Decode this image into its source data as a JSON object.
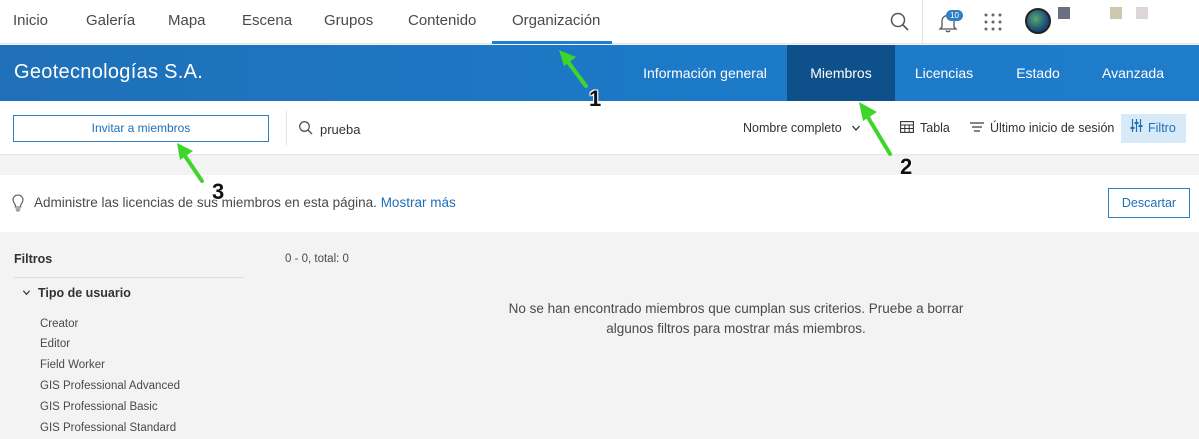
{
  "topnav": {
    "items": [
      "Inicio",
      "Galería",
      "Mapa",
      "Escena",
      "Grupos",
      "Contenido",
      "Organización"
    ],
    "active": "Organización",
    "notifications_count": "10"
  },
  "org": {
    "name": "Geotecnologías S.A.",
    "tabs": [
      "Información general",
      "Miembros",
      "Licencias",
      "Estado",
      "Avanzada"
    ],
    "selected_tab": "Miembros"
  },
  "toolbar": {
    "invite_label": "Invitar a miembros",
    "search_value": "prueba",
    "sort_label": "Nombre completo",
    "view_label": "Tabla",
    "last_login_label": "Último inicio de sesión",
    "filter_label": "Filtro"
  },
  "notice": {
    "text": "Administre las licencias de sus miembros en esta página.",
    "link": "Mostrar más",
    "dismiss_label": "Descartar"
  },
  "filters": {
    "title": "Filtros",
    "group": "Tipo de usuario",
    "options": [
      "Creator",
      "Editor",
      "Field Worker",
      "GIS Professional Advanced",
      "GIS Professional Basic",
      "GIS Professional Standard"
    ]
  },
  "results": {
    "count": "0 - 0, total: 0",
    "empty_line1": "No se han encontrado miembros que cumplan sus criterios. Pruebe a borrar",
    "empty_line2": "algunos filtros para mostrar más miembros."
  },
  "annotations": [
    "1",
    "2",
    "3"
  ],
  "colors": {
    "accent": "#1d7fd6",
    "band": "#1c76c3",
    "selected_tab": "#0e5089",
    "arrow": "#3fd52a"
  }
}
